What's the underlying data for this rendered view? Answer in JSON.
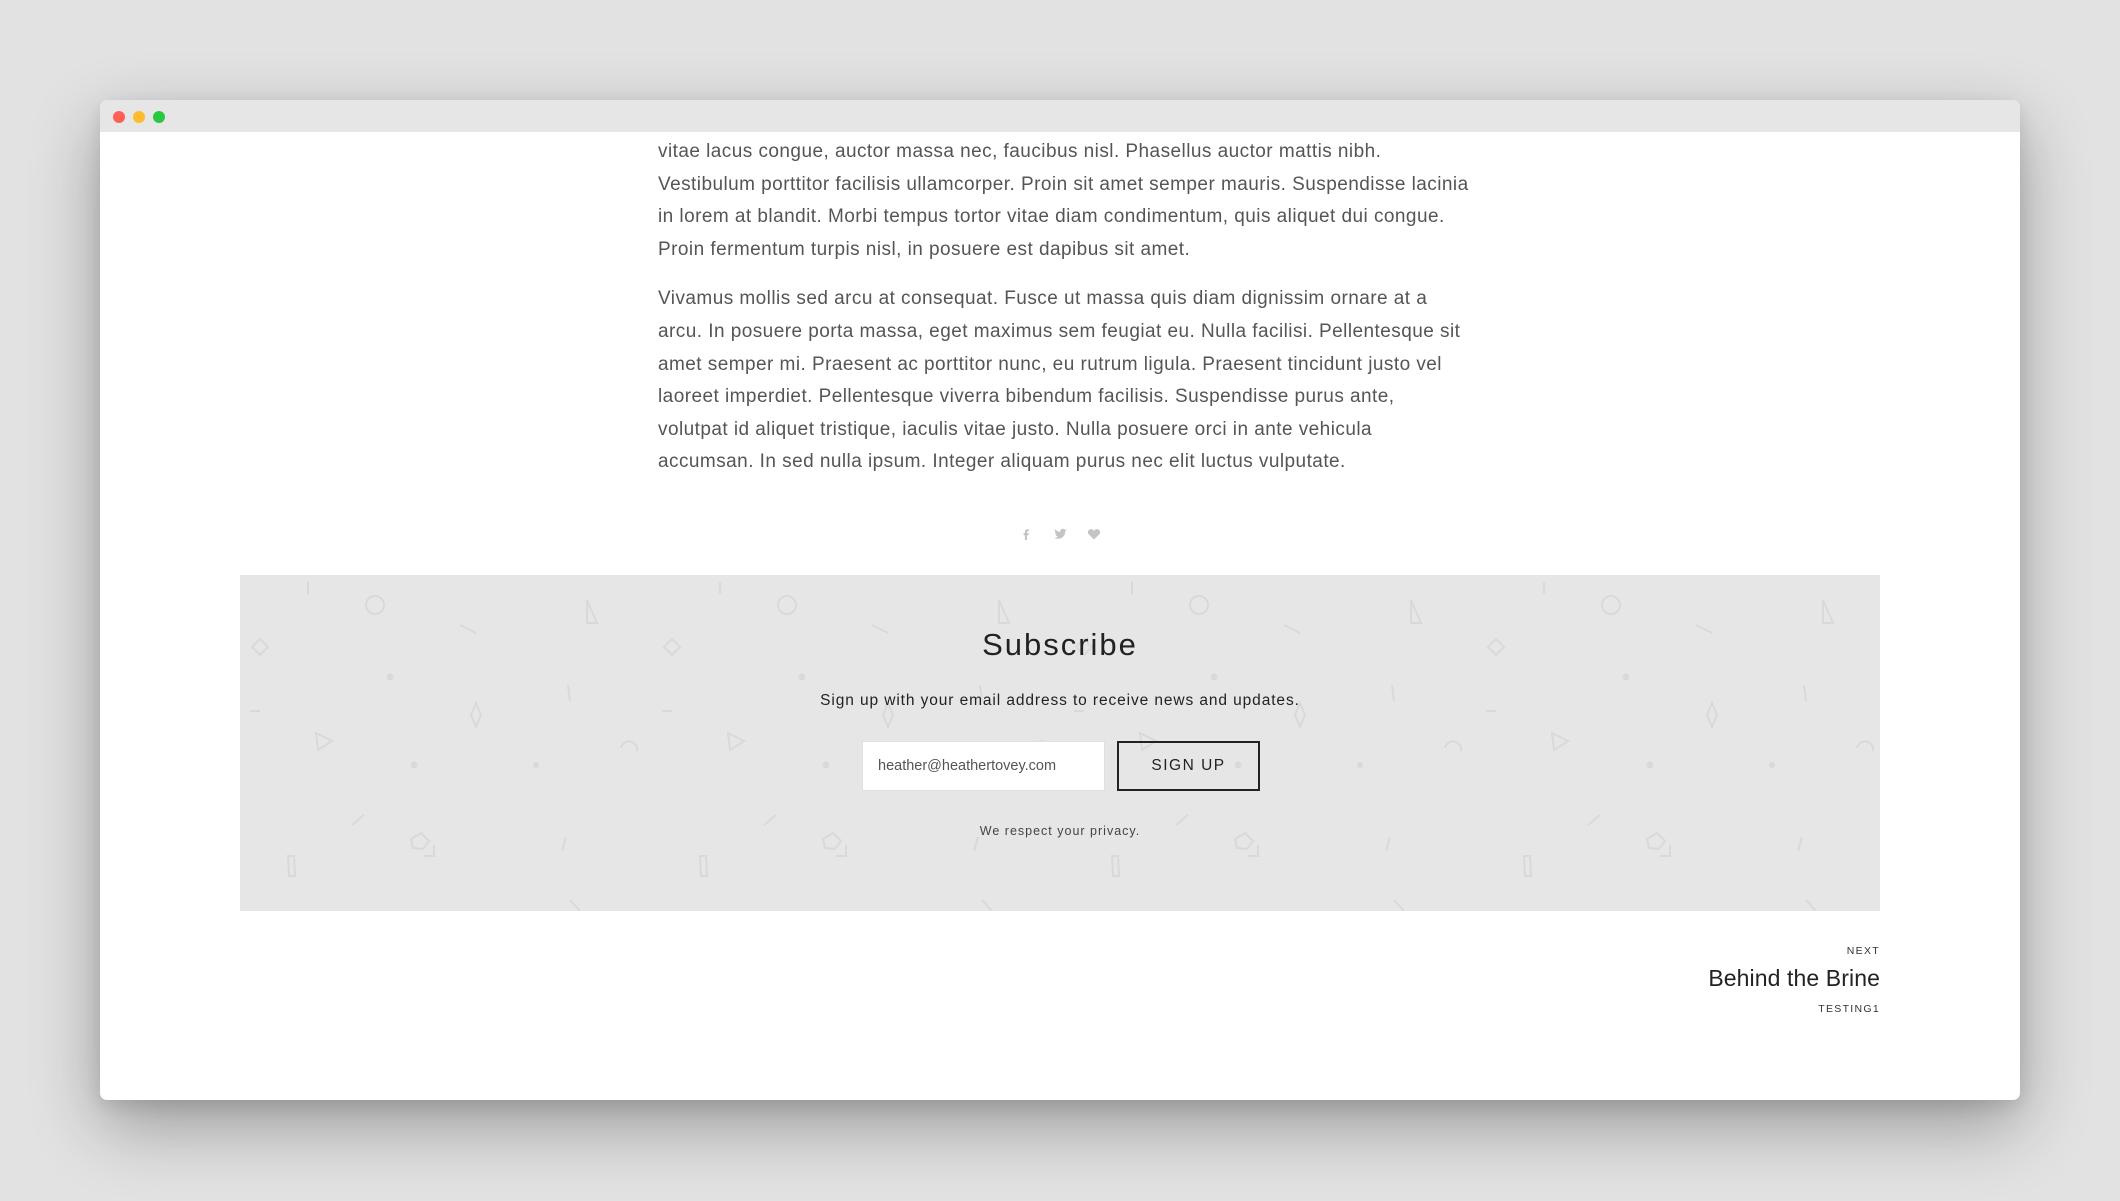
{
  "window": {
    "controls": [
      "close",
      "minimize",
      "maximize"
    ]
  },
  "article": {
    "paragraphs": [
      "vitae lacus congue, auctor massa nec, faucibus nisl. Phasellus auctor mattis nibh. Vestibulum porttitor facilisis ullamcorper. Proin sit amet semper mauris. Suspendisse lacinia in lorem at blandit. Morbi tempus tortor vitae diam condimentum, quis aliquet dui congue. Proin fermentum turpis nisl, in posuere est dapibus sit amet.",
      "Vivamus mollis sed arcu at consequat. Fusce ut massa quis diam dignissim ornare at a arcu. In posuere porta massa, eget maximus sem feugiat eu. Nulla facilisi. Pellentesque sit amet semper mi. Praesent ac porttitor nunc, eu rutrum ligula. Praesent tincidunt justo vel laoreet imperdiet. Pellentesque viverra bibendum facilisis. Suspendisse purus ante, volutpat id aliquet tristique, iaculis vitae justo. Nulla posuere orci in ante vehicula accumsan. In sed nulla ipsum. Integer aliquam purus nec elit luctus vulputate."
    ]
  },
  "share": {
    "icons": [
      "facebook-icon",
      "twitter-icon",
      "heart-icon"
    ],
    "color": "#c4c4c4"
  },
  "subscribe": {
    "title": "Subscribe",
    "description": "Sign up with your email address to receive news and updates.",
    "email_value": "heather@heathertovey.com",
    "button_label": "SIGN UP",
    "privacy": "We respect your privacy.",
    "background": "#e6e6e6"
  },
  "next_post": {
    "label": "NEXT",
    "title": "Behind the Brine",
    "tag": "TESTING1"
  }
}
